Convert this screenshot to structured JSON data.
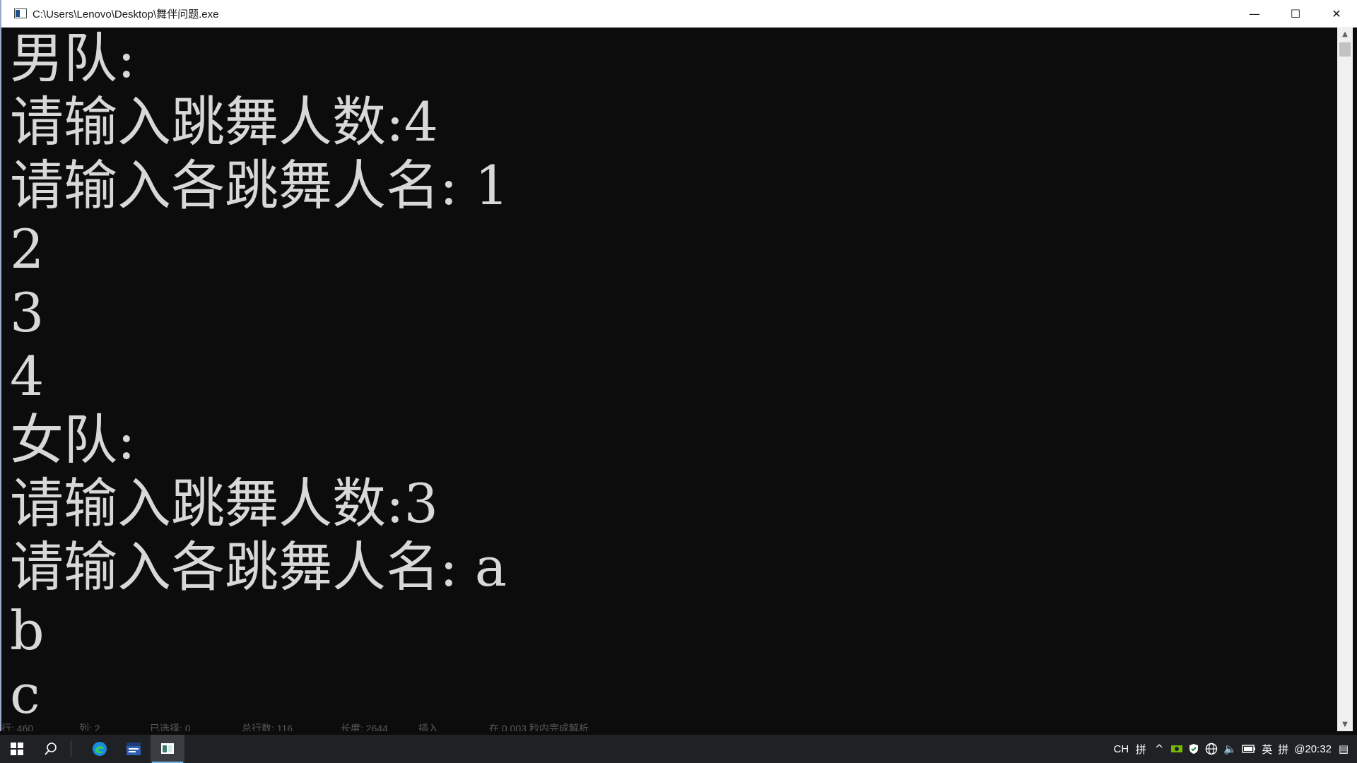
{
  "window": {
    "title": "C:\\Users\\Lenovo\\Desktop\\舞伴问题.exe",
    "minimize_glyph": "—",
    "maximize_glyph": "☐",
    "close_glyph": "✕"
  },
  "console": {
    "lines": [
      "男队:",
      "请输入跳舞人数:4",
      "请输入各跳舞人名: 1",
      "2",
      "3",
      "4",
      "女队:",
      "请输入跳舞人数:3",
      "请输入各跳舞人名: a",
      "b",
      "c"
    ]
  },
  "scrollbar": {
    "up_glyph": "▲",
    "down_glyph": "▼"
  },
  "statusbar": {
    "cells": [
      "行: 460",
      "列: 2",
      "已选择: 0",
      "总行数: 116",
      "长度: 2644",
      "插入",
      "在 0.003 秒内完成解析"
    ]
  },
  "taskbar": {
    "start_icon": "windows-start-icon",
    "search_glyph": "⚲",
    "apps": [
      {
        "name": "edge-icon",
        "active": false
      },
      {
        "name": "devcpp-icon",
        "active": false
      },
      {
        "name": "console-app-icon",
        "active": true
      }
    ]
  },
  "tray": {
    "lang_short": "CH",
    "ime_glyph": "拼",
    "chevron": "^",
    "volume_glyph": "🔈",
    "ime_lang": "英",
    "ime_mode": "拼",
    "clock": "@20:32",
    "notification_glyph": "▤"
  },
  "colors": {
    "console_bg": "#0c0c0c",
    "console_fg": "#d8d8d8",
    "taskbar_bg": "#1f2125",
    "accent": "#76b9ed"
  }
}
